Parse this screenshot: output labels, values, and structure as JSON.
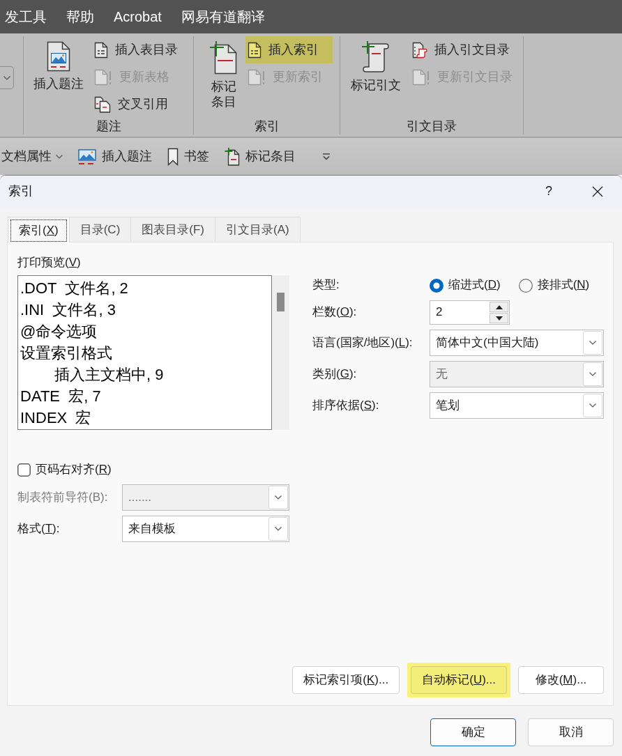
{
  "menu_bar": {
    "items": [
      "发工具",
      "帮助",
      "Acrobat",
      "网易有道翻译"
    ]
  },
  "ribbon": {
    "groups": [
      {
        "label": "题注",
        "large_button": {
          "label": "插入题注"
        },
        "small_buttons": [
          {
            "label": "插入表目录",
            "disabled": false,
            "highlighted": false
          },
          {
            "label": "更新表格",
            "disabled": true,
            "highlighted": false
          },
          {
            "label": "交叉引用",
            "disabled": false,
            "highlighted": false
          }
        ]
      },
      {
        "label": "索引",
        "large_button": {
          "label": "标记条目"
        },
        "small_buttons": [
          {
            "label": "插入索引",
            "disabled": false,
            "highlighted": true
          },
          {
            "label": "更新索引",
            "disabled": true,
            "highlighted": false
          }
        ]
      },
      {
        "label": "引文目录",
        "large_button": {
          "label": "标记引文"
        },
        "small_buttons": [
          {
            "label": "插入引文目录",
            "disabled": false,
            "highlighted": false
          },
          {
            "label": "更新引文目录",
            "disabled": true,
            "highlighted": false
          }
        ]
      }
    ]
  },
  "quick_access_toolbar": {
    "items": [
      {
        "kind": "dropdown",
        "label": "文档属性"
      },
      {
        "kind": "button",
        "label": "插入题注"
      },
      {
        "kind": "button",
        "label": "书签"
      },
      {
        "kind": "button",
        "label": "标记条目"
      }
    ]
  },
  "dialog": {
    "title": "索引",
    "help_label": "?",
    "tabs": [
      {
        "label": "索引(",
        "access_key": "X",
        "label_rest": ")",
        "selected": true
      },
      {
        "label": "目录(C)",
        "selected": false
      },
      {
        "label": "图表目录(F)",
        "selected": false
      },
      {
        "label": "引文目录(A)",
        "selected": false
      }
    ],
    "preview": {
      "label": "打印预览(",
      "access_key": "V",
      "label_rest": ")",
      "entries": [
        {
          "text": ".DOT  文件名, 2"
        },
        {
          "text": ".INI  文件名, 3"
        },
        {
          "text": "@命令选项"
        },
        {
          "text": "设置索引格式",
          "children": [
            {
              "text": "插入主文档中, 9"
            }
          ]
        },
        {
          "text": "DATE  宏, 7"
        },
        {
          "text": "INDEX  宏"
        }
      ]
    },
    "settings": [
      {
        "kind": "radios",
        "label": "类型:",
        "options": [
          {
            "label": "缩进式(",
            "access_key": "D",
            "label_rest": ")",
            "selected": true
          },
          {
            "label": "接排式(",
            "access_key": "N",
            "label_rest": ")",
            "selected": false
          }
        ]
      },
      {
        "kind": "spin",
        "label": "栏数(",
        "access_key": "O",
        "label_rest": "):",
        "value": "2"
      },
      {
        "kind": "dropdown",
        "label": "语言(国家/地区)(",
        "access_key": "L",
        "label_rest": "):",
        "value": "简体中文(中国大陆)",
        "disabled": false
      },
      {
        "kind": "dropdown",
        "label": "类别(",
        "access_key": "G",
        "label_rest": "):",
        "value": "无",
        "disabled": true
      },
      {
        "kind": "dropdown",
        "label": "排序依据(",
        "access_key": "S",
        "label_rest": "):",
        "value": "笔划",
        "disabled": false
      }
    ],
    "layout_options": [
      {
        "kind": "checkbox",
        "label": "页码右对齐(",
        "access_key": "R",
        "label_rest": ")",
        "checked": false
      },
      {
        "kind": "dropdown",
        "label": "制表符前导符(B):",
        "value": ".......",
        "disabled": true
      },
      {
        "kind": "dropdown",
        "label": "格式(",
        "access_key": "T",
        "label_rest": "):",
        "value": "来自模板",
        "disabled": false
      }
    ],
    "actions": [
      {
        "label": "标记索引项(",
        "access_key": "K",
        "label_rest": ")...",
        "highlighted": false
      },
      {
        "label": "自动标记(",
        "access_key": "U",
        "label_rest": ")...",
        "highlighted": true
      },
      {
        "label": "修改(",
        "access_key": "M",
        "label_rest": ")...",
        "highlighted": false
      }
    ],
    "footer_buttons": [
      {
        "label": "确定",
        "default": true
      },
      {
        "label": "取消",
        "default": false
      }
    ]
  }
}
